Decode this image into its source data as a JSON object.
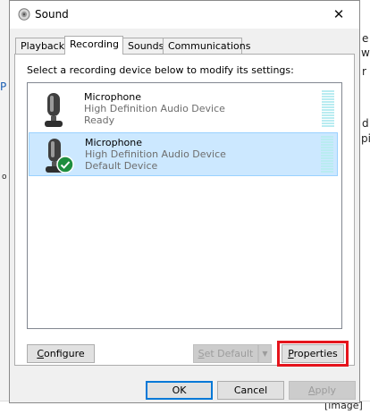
{
  "window": {
    "title": "Sound",
    "close_glyph": "✕"
  },
  "tabs": [
    {
      "label": "Playback",
      "active": false
    },
    {
      "label": "Recording",
      "active": true
    },
    {
      "label": "Sounds",
      "active": false
    },
    {
      "label": "Communications",
      "active": false
    }
  ],
  "instruction": "Select a recording device below to modify its settings:",
  "devices": [
    {
      "name": "Microphone",
      "description": "High Definition Audio Device",
      "status": "Ready",
      "selected": false,
      "default": false
    },
    {
      "name": "Microphone",
      "description": "High Definition Audio Device",
      "status": "Default Device",
      "selected": true,
      "default": true
    }
  ],
  "panel_buttons": {
    "configure": {
      "prefix": "",
      "mnemonic": "C",
      "rest": "onfigure"
    },
    "set_default": {
      "prefix": "",
      "mnemonic": "S",
      "rest": "et Default",
      "arrow": "▼"
    },
    "properties": {
      "prefix": "",
      "mnemonic": "P",
      "rest": "roperties"
    }
  },
  "dialog_buttons": {
    "ok": "OK",
    "cancel": "Cancel",
    "apply": {
      "mnemonic": "A",
      "rest": "pply"
    }
  },
  "background_fragments": [
    {
      "id": "r1",
      "text": "e"
    },
    {
      "id": "r2",
      "text": "wi"
    },
    {
      "id": "r3",
      "text": "r"
    },
    {
      "id": "r4",
      "text": "d"
    },
    {
      "id": "r5",
      "text": "pi"
    },
    {
      "id": "r6",
      "text": "P"
    },
    {
      "id": "r7",
      "text": "o"
    },
    {
      "id": "r8",
      "text": "[image]"
    }
  ],
  "colors": {
    "accent": "#0078d7",
    "selection": "#cce8ff",
    "highlight_box": "#e5141c",
    "check_badge": "#1e8e3e"
  },
  "icons": {
    "title": "speaker-icon",
    "device": "microphone-icon",
    "default_badge": "checkmark-icon"
  }
}
